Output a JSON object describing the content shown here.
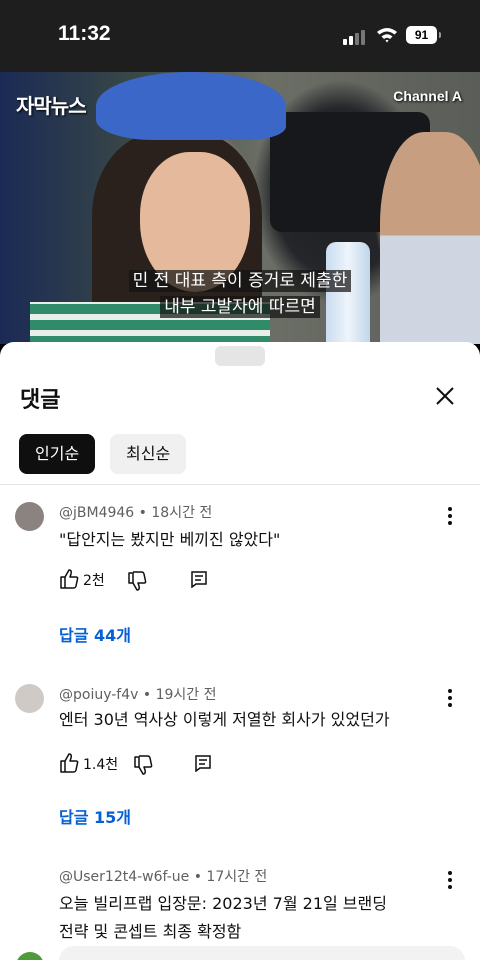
{
  "status": {
    "time": "11:32",
    "battery": "91"
  },
  "video": {
    "logo_left": "자막뉴스",
    "logo_right": "Channel A",
    "subtitle_line1": "민 전 대표 측이 증거로 제출한",
    "subtitle_line2": "내부 고발자에 따르면"
  },
  "comments_panel": {
    "title": "댓글",
    "sort_tabs": [
      {
        "label": "인기순",
        "active": true
      },
      {
        "label": "최신순",
        "active": false
      }
    ]
  },
  "comments": [
    {
      "author": "@jBM4946",
      "time": "18시간 전",
      "text": "\"답안지는 봤지만 베끼진 않았다\"",
      "likes": "2천",
      "replies_label": "답글 44개",
      "avatar_color": "#8a8380"
    },
    {
      "author": "@poiuy-f4v",
      "time": "19시간 전",
      "text": "엔터 30년 역사상 이렇게 저열한 회사가 있었던가",
      "likes": "1.4천",
      "replies_label": "답글 15개",
      "avatar_color": "#cfcac6"
    },
    {
      "author": "@User12t4-w6f-ue",
      "time": "17시간 전",
      "text_line1": "오늘 빌리프랩 입장문: 2023년 7월 21일 브랜딩",
      "text_line2": "전략 및 콘셉트 최종 확정함"
    }
  ],
  "meta_separator": "•",
  "colors": {
    "link": "#065fd4",
    "chip_active": "#0f0f0f",
    "chip_inactive": "#f0f0f0"
  }
}
